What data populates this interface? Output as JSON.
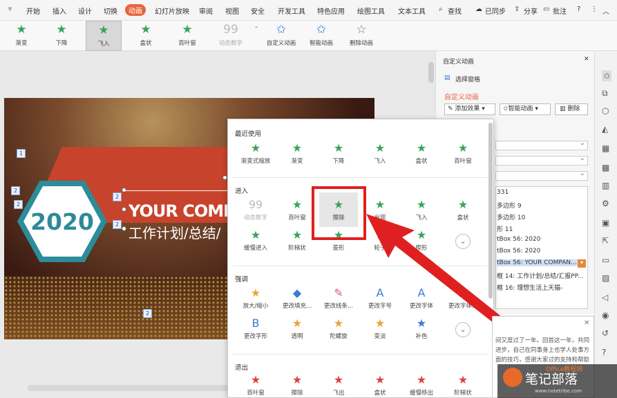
{
  "menubar": {
    "items": [
      "开始",
      "插入",
      "设计",
      "切换",
      "动画",
      "幻灯片放映",
      "审阅",
      "视图",
      "安全",
      "开发工具",
      "特色应用",
      "绘图工具",
      "文本工具"
    ],
    "active": "动画",
    "search": "查找",
    "sync": "已同步",
    "share": "分享",
    "comment": "批注"
  },
  "ribbon": {
    "effects": [
      {
        "label": "渐变",
        "icon": "fade-star-icon"
      },
      {
        "label": "下降",
        "icon": "descend-star-icon"
      },
      {
        "label": "飞入",
        "icon": "fly-in-star-icon",
        "selected": true
      },
      {
        "label": "盒状",
        "icon": "box-star-icon"
      },
      {
        "label": "百叶窗",
        "icon": "blinds-star-icon"
      },
      {
        "label": "动态数字",
        "icon": "dynamic-number-icon",
        "disabled": true
      }
    ],
    "actions": [
      "自定义动画",
      "智能动画",
      "删除动画"
    ]
  },
  "slide": {
    "year": "2020",
    "title_en": "YOUR COMP",
    "title_cn": "工作计划/总结/",
    "tags": [
      "1",
      "2",
      "2",
      "2",
      "2",
      "2"
    ]
  },
  "popup": {
    "sections": [
      {
        "title": "最近使用",
        "items": [
          "渐变式缩放",
          "渐变",
          "下降",
          "飞入",
          "盒状",
          "百叶窗"
        ]
      },
      {
        "title": "进入",
        "items": [
          "动态数字",
          "百叶窗",
          "擦除",
          "出现",
          "飞入",
          "盒状",
          "缓慢进入",
          "阶梯状",
          "菱形",
          "轮子",
          "楔形"
        ]
      },
      {
        "title": "强调",
        "items": [
          "放大/缩小",
          "更改填充...",
          "更改线条...",
          "更改字号",
          "更改字体",
          "更改字体...",
          "更改字形",
          "透明",
          "陀螺旋",
          "变淡",
          "补色"
        ]
      },
      {
        "title": "退出",
        "items": [
          "百叶窗",
          "擦除",
          "飞出",
          "盒状",
          "缓慢移出",
          "阶梯状"
        ]
      }
    ],
    "highlighted": "擦除"
  },
  "panel": {
    "header": "自定义动画",
    "select_pane": "选择窗格",
    "title": "自定义动画",
    "add_effect": "添加效果",
    "smart_anim": "智能动画",
    "delete": "删除",
    "list": [
      "331",
      "多边形 9",
      "多边形 10",
      "形 11",
      "tBox 56: 2020",
      "tBox 56: 2020",
      "tBox 56: YOUR COMPAN...",
      "框 14: 工作计划/总结/汇报PP...",
      "框 16: 理想生活上天猫-"
    ]
  },
  "tip": {
    "text": "间又度过了一年。回首这一年，共同进步，自己在同事身上也学人处事方面的技巧，感谢大家过的支持和帮助"
  },
  "watermark": {
    "text": "笔记部落",
    "url": "www.notetribe.com",
    "brand": "Office教程网"
  },
  "colors": {
    "accent": "#e8643c",
    "highlight": "#e02020",
    "star_green": "#3aa35b",
    "teal": "#2b8c9a"
  }
}
